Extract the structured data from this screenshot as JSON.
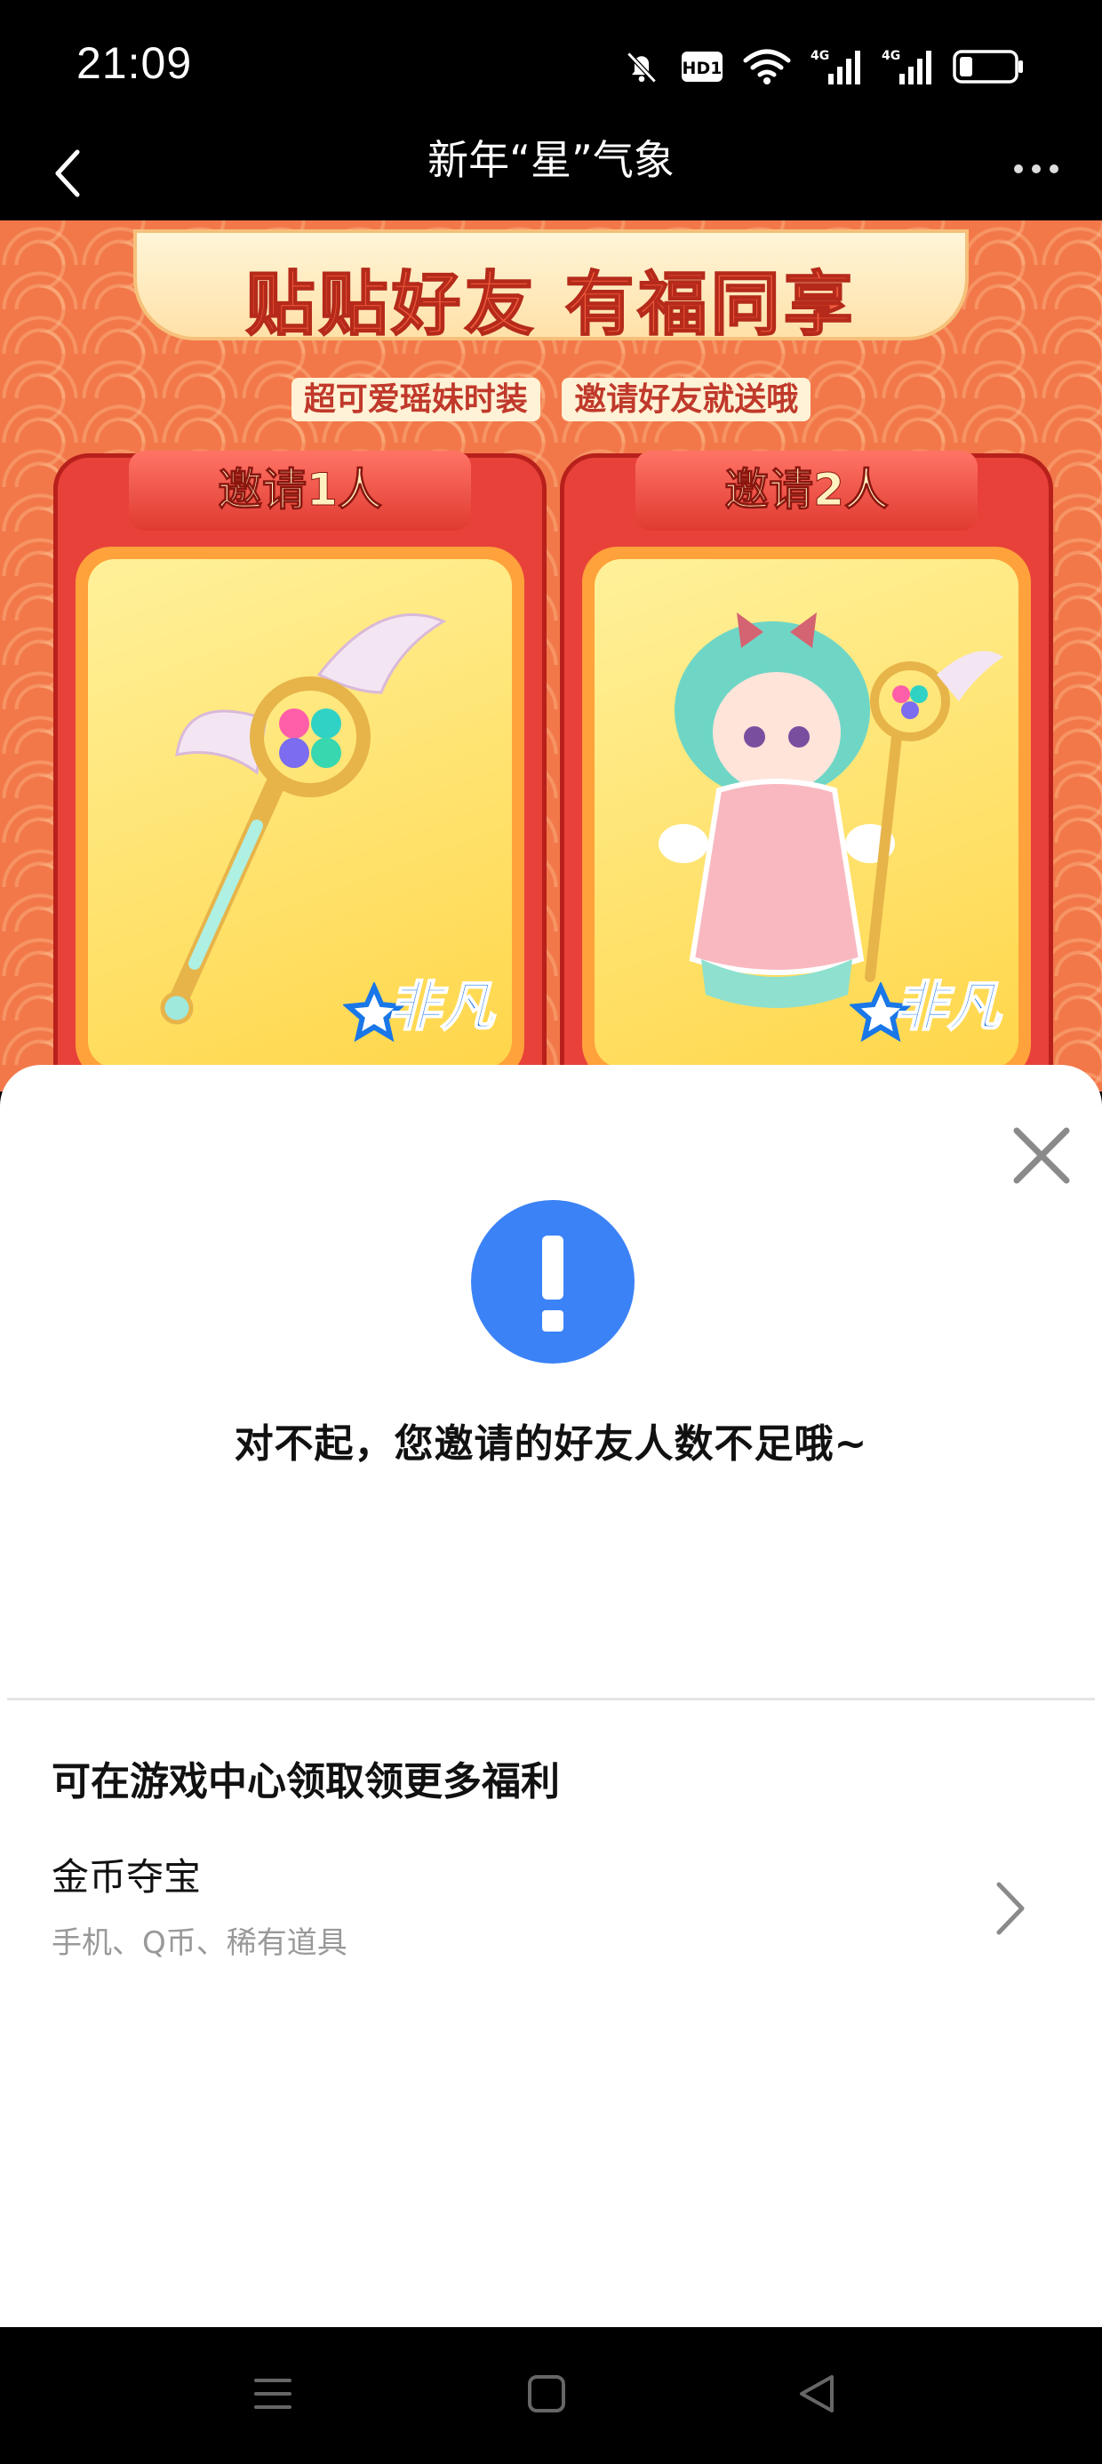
{
  "status_bar": {
    "time": "21:09",
    "icons": [
      "mute-bell-icon",
      "hd-icon",
      "wifi-icon",
      "4g-signal-icon",
      "4g-signal-icon",
      "battery-icon"
    ],
    "hd_label": "HD1",
    "network_label": "4G"
  },
  "title_bar": {
    "title": "新年“星”气象",
    "back_icon": "chevron-left-icon",
    "more_icon": "more-dots-icon"
  },
  "banner": {
    "heading": "贴贴好友 有福同享",
    "subtitle_left": "超可爱瑶妹时装",
    "subtitle_right": "邀请好友就送哦",
    "cards": [
      {
        "tab_label": "邀请1人",
        "rarity": "非凡"
      },
      {
        "tab_label": "邀请2人",
        "rarity": "非凡"
      }
    ]
  },
  "sheet": {
    "close_icon": "close-icon",
    "alert_icon": "exclamation-icon",
    "message": "对不起，您邀请的好友人数不足哦~",
    "section_title": "可在游戏中心领取领更多福利",
    "benefit": {
      "title": "金币夺宝",
      "subtitle": "手机、Q币、稀有道具"
    }
  },
  "colors": {
    "accent_blue": "#3b82f6",
    "banner_orange": "#f2784a",
    "card_red": "#e8413a"
  },
  "nav_bar": {
    "icons": [
      "menu-icon",
      "home-square-icon",
      "back-triangle-icon"
    ]
  }
}
